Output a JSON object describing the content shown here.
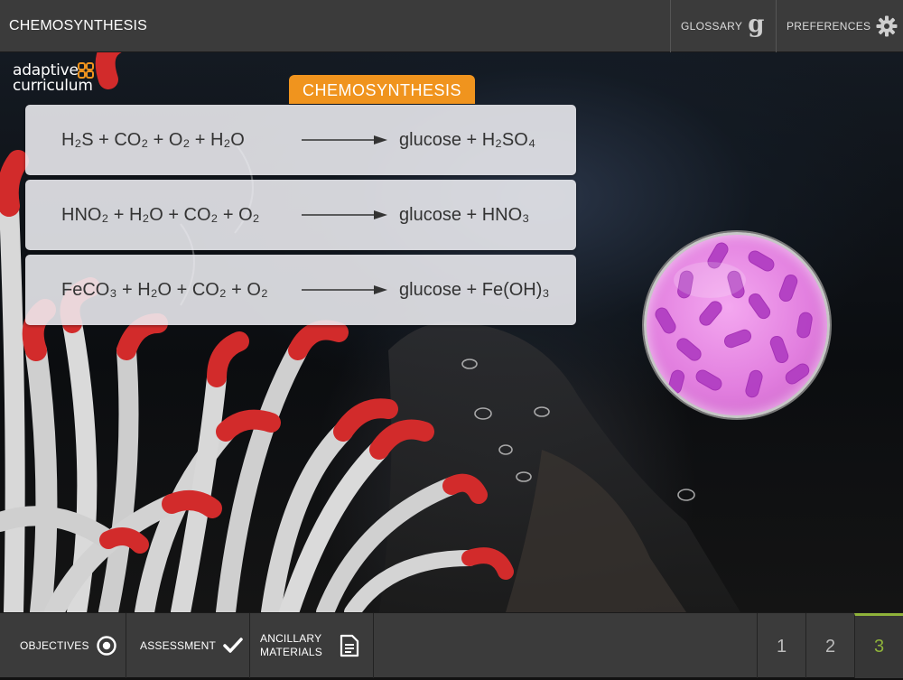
{
  "header": {
    "title": "CHEMOSYNTHESIS",
    "glossary_label": "GLOSSARY",
    "glossary_glyph": "g",
    "preferences_label": "PREFERENCES"
  },
  "logo": {
    "line1": "adaptive",
    "line2": "curriculum"
  },
  "content": {
    "section_title": "CHEMOSYNTHESIS",
    "equations": [
      {
        "reactants": "H₂S + CO₂ + O₂ + H₂O",
        "products": "glucose + H₂SO₄"
      },
      {
        "reactants": "HNO₂ + H₂O + CO₂ + O₂",
        "products": "glucose + HNO₃"
      },
      {
        "reactants": "FeCO₃ + H₂O + CO₂ + O₂",
        "products": "glucose + Fe(OH)₃"
      }
    ]
  },
  "footer": {
    "objectives_label": "OBJECTIVES",
    "assessment_label": "ASSESSMENT",
    "ancillary_label": "ANCILLARY MATERIALS",
    "pages": [
      "1",
      "2",
      "3"
    ],
    "current_page": "3"
  },
  "colors": {
    "accent_orange": "#f0941e",
    "active_page_green": "#8fb33a",
    "bar_gray": "#3b3b3b",
    "microbe_pink": "#e27fdf",
    "bacteria_purple": "#b23fc2"
  },
  "icons": [
    "glossary-g-icon",
    "gear-icon",
    "target-icon",
    "checkmark-icon",
    "document-icon",
    "arrow-icon"
  ]
}
